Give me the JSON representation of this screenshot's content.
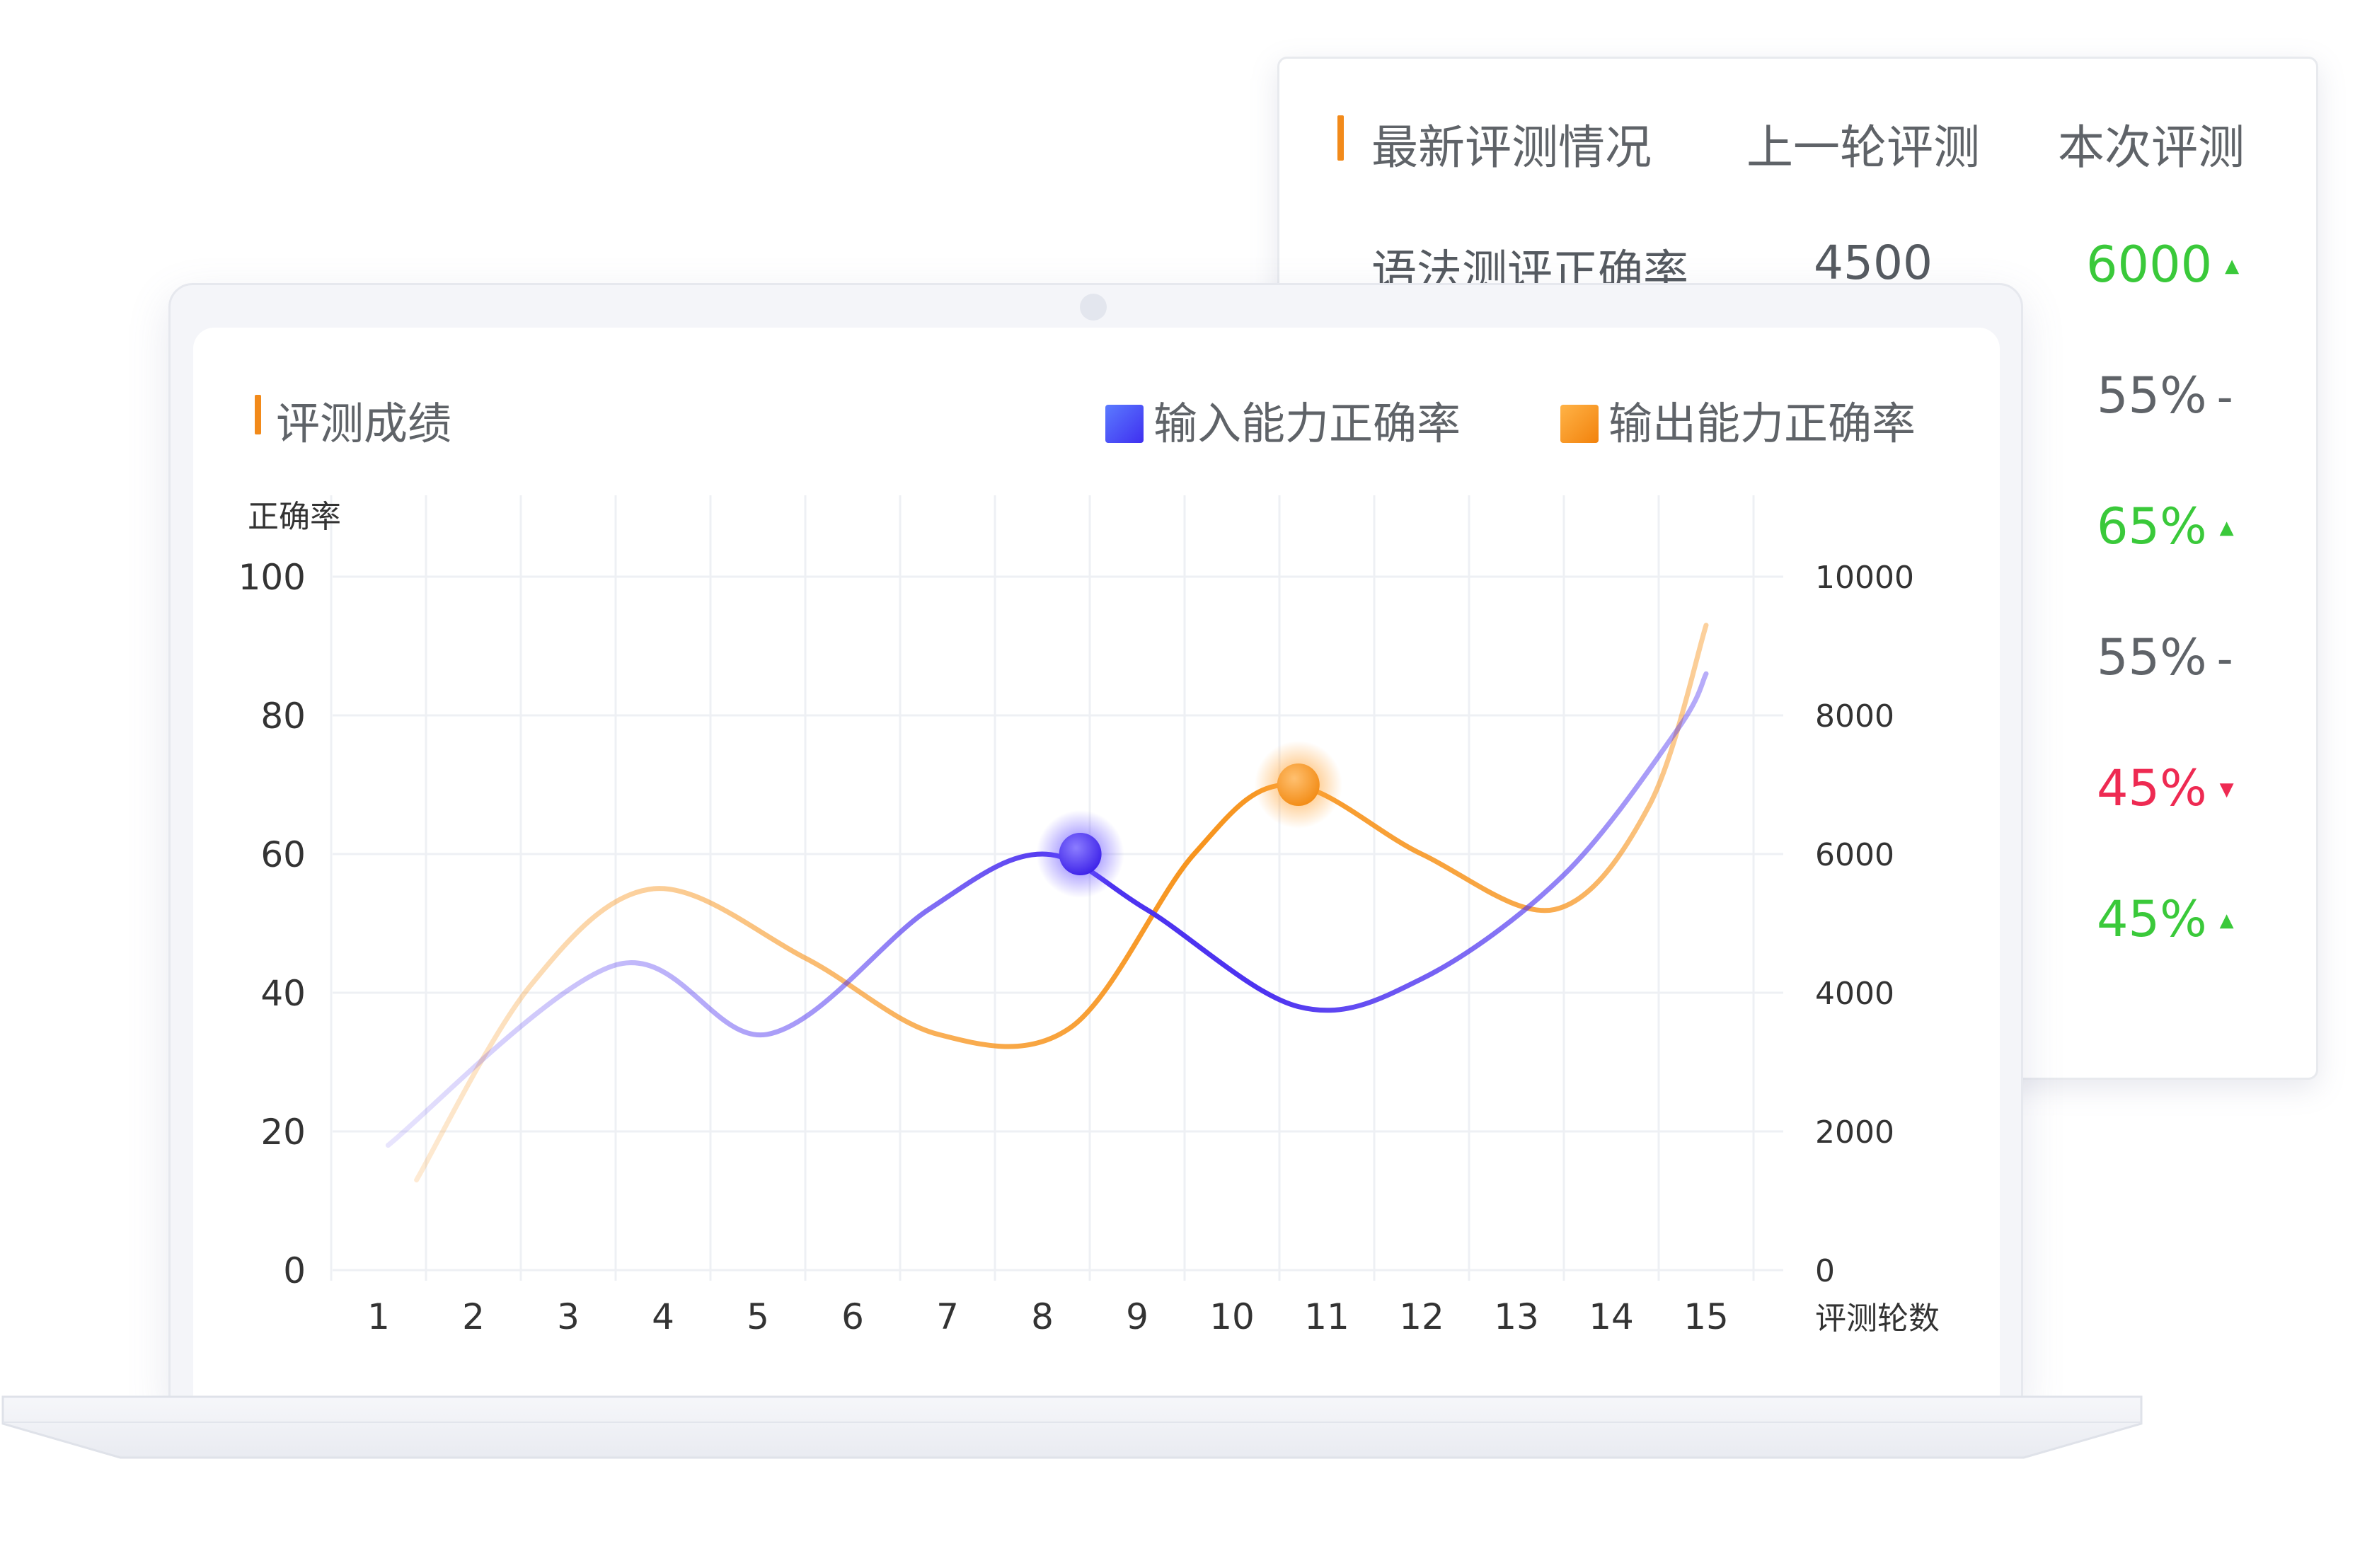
{
  "panel": {
    "title": "最新评测情况",
    "col_prev": "上一轮评测",
    "col_current": "本次评测",
    "accent_color": "#f28a1a",
    "rows": [
      {
        "name": "语法测评正确率",
        "prev": "4500",
        "current": "6000",
        "trend": "▲",
        "trend_type": "up"
      },
      {
        "name": "",
        "prev": "",
        "current": "55%",
        "trend": "-",
        "trend_type": "flat"
      },
      {
        "name": "",
        "prev": "",
        "current": "65%",
        "trend": "▲",
        "trend_type": "up"
      },
      {
        "name": "",
        "prev": "",
        "current": "55%",
        "trend": "-",
        "trend_type": "flat"
      },
      {
        "name": "",
        "prev": "",
        "current": "45%",
        "trend": "▼",
        "trend_type": "down"
      },
      {
        "name": "",
        "prev": "",
        "current": "45%",
        "trend": "▲",
        "trend_type": "up"
      }
    ],
    "colors": {
      "up": "#3ac93a",
      "flat": "#5f6368",
      "down": "#ee2a52"
    }
  },
  "chart_data": {
    "type": "line",
    "title": "评测成绩",
    "ylabel": "正确率",
    "xlabel": "评测轮数",
    "categories": [
      "1",
      "2",
      "3",
      "4",
      "5",
      "6",
      "7",
      "8",
      "9",
      "10",
      "11",
      "12",
      "13",
      "14",
      "15"
    ],
    "ylim": [
      0,
      100
    ],
    "yticks": [
      "0",
      "20",
      "40",
      "60",
      "80",
      "100"
    ],
    "y2lim": [
      0,
      10000
    ],
    "y2ticks": [
      "0",
      "2000",
      "4000",
      "6000",
      "8000",
      "10000"
    ],
    "grid": true,
    "legend_position": "top-right",
    "series": [
      {
        "name": "输入能力正确率",
        "color": "#4d33f0",
        "swatch_color": "#4a5cf5",
        "x": [
          0.1,
          2.5,
          4.1,
          5.8,
          7.0,
          8.1,
          9.7,
          11.0,
          12.5,
          13.7,
          14.0
        ],
        "y": [
          18,
          44,
          34,
          52,
          60,
          52,
          38,
          42,
          57,
          78,
          86
        ],
        "highlight": {
          "x": 7.4,
          "y": 60
        }
      },
      {
        "name": "输出能力正确率",
        "color": "#f7941d",
        "swatch_color": "#f7941d",
        "x": [
          0.4,
          1.6,
          2.9,
          4.5,
          5.9,
          7.3,
          8.6,
          9.6,
          11.0,
          12.4,
          13.4,
          14.0
        ],
        "y": [
          13,
          41,
          55,
          45,
          34,
          35,
          60,
          70,
          60,
          52,
          67,
          93
        ],
        "highlight": {
          "x": 9.7,
          "y": 70
        }
      }
    ]
  }
}
